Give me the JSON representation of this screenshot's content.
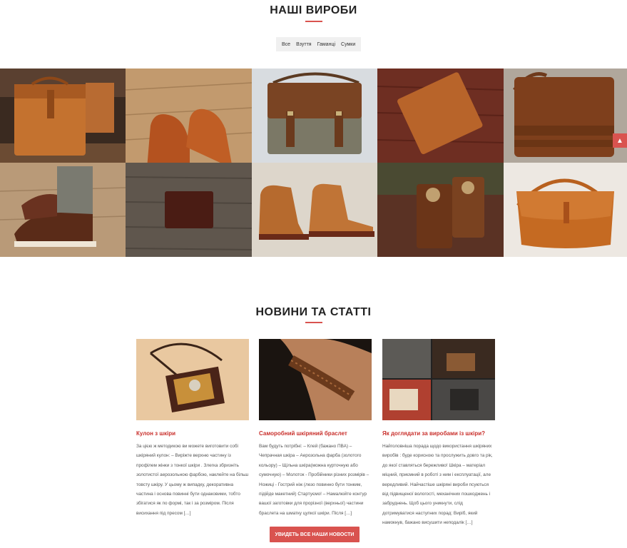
{
  "products": {
    "title": "НАШІ ВИРОБИ",
    "filters": [
      "Все",
      "Взуття",
      "Гаманці",
      "Сумки"
    ]
  },
  "news": {
    "title": "НОВИНИ ТА СТАТТІ",
    "cards": [
      {
        "title": "Кулон з шкіри",
        "text": "За цією ж методикою ви можете виготовити собі шкіряний кулон: – Виріжте верхню частину із профілем жінки з тонкої шкіри . Злегка збризніть золотистої аерозольною фарбою, наклейте на більш товсту шкіру. У цьому ж випадку, декоративна частина і основа повинні бути однаковими, тобто збігатися як по формі, так і за розміром. Після висихання під пресом […]"
      },
      {
        "title": "Саморобний шкіряний браслет",
        "text": "Вам будуть потрібні: – Клей (бажано ПВА) – Чепрачная шкіра – Аерозольна фарба (золотого кольору) – Щільна шкіра(можна курточную або сумочную) – Молоток - Пробійники різних розмірів – Ножиці - Гострий ніж (лезо повинно бути тонким, підійде макетний) Стартуємо! – Намалюйте контур вашої заготовки для прорізної (верхньої) частини браслета на шматку цупкої шкіри. Після […]"
      },
      {
        "title": "Як доглядати за виробами із шкіри?",
        "text": "Найголовніша порада щодо використання шкіряних виробів : буде корисною та прослужить довго та рік, до якої ставляться бережливо! Шкіра – матеріал міцний, приємний в роботі з ним і експлуатації, але вередливий. Найчастіше шкіряні вироби псуються від підвищеної вологості, механічних пошкоджень і забруднень. Щоб цього уникнути, слід дотримуватися наступних порад: Виріб, який намокнув, бажано висушити неподалік […]"
      }
    ],
    "cta_label": "УВИДЕТЬ ВСЕ НАШИ НОВОСТИ"
  },
  "scroll_top_icon": "arrow-up-icon",
  "colors": {
    "accent": "#d9534f",
    "link": "#c9302c",
    "filter_bg": "#f0f0f0"
  }
}
